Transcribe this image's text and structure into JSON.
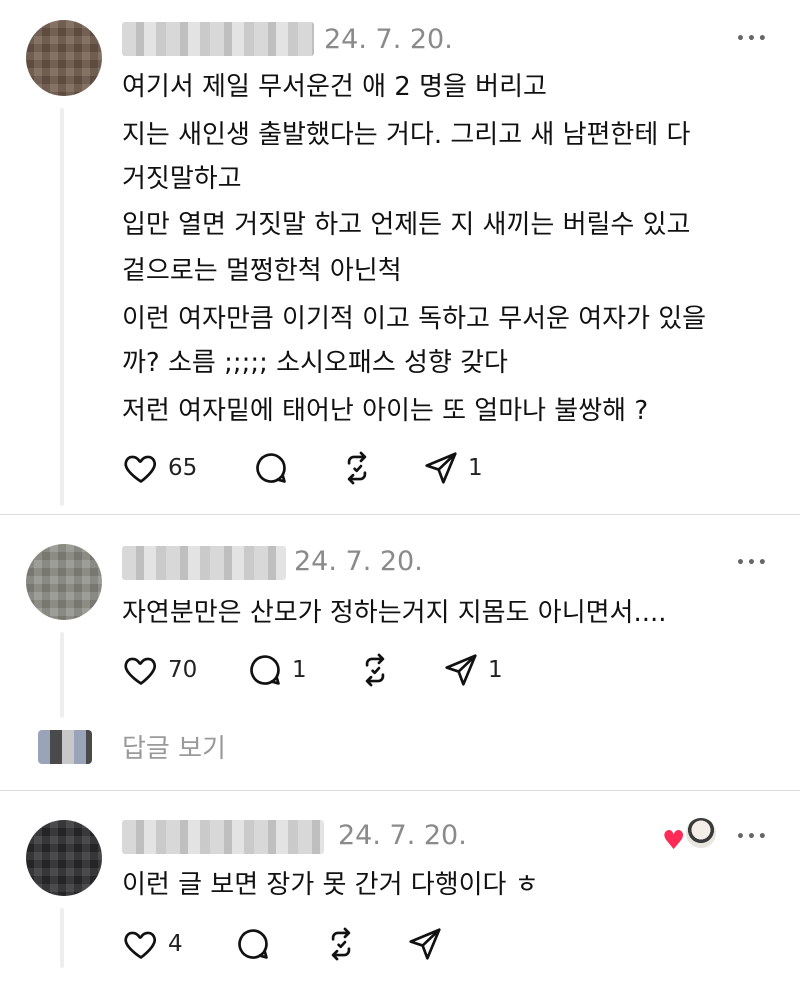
{
  "colors": {
    "liked_heart": "#ff2a55",
    "meta_gray": "#8a8a8a",
    "text": "#111111"
  },
  "comments": [
    {
      "date": "24. 7. 20.",
      "lines": [
        "여기서 제일 무서운건 애 2 명을 버리고",
        "지는 새인생 출발했다는 거다. 그리고 새 남편한테 다",
        "거짓말하고",
        "입만 열면 거짓말 하고 언제든 지 새끼는 버릴수 있고",
        "겉으로는 멀쩡한척 아닌척",
        "이런 여자만큼 이기적 이고 독하고 무서운 여자가 있을",
        "까? 소름 ;;;;; 소시오패스 성향 갖다",
        "저런 여자밑에 태어난 아이는 또 얼마나 불쌍해 ?"
      ],
      "likes": "65",
      "replies": "",
      "reposts": "",
      "shares": "1"
    },
    {
      "date": "24. 7. 20.",
      "lines": [
        "자연분만은 산모가 정하는거지 지몸도 아니면서...."
      ],
      "likes": "70",
      "replies": "1",
      "reposts": "",
      "shares": "1"
    },
    {
      "date": "24. 7. 20.",
      "lines": [
        "이런 글 보면 장가 못 간거 다행이다 ㅎ"
      ],
      "likes": "4",
      "replies": "",
      "reposts": "",
      "shares": ""
    }
  ],
  "view_replies_label": "답글 보기",
  "icons": {
    "more": "more-icon",
    "like": "heart-icon",
    "reply": "comment-icon",
    "repost": "repost-icon",
    "share": "send-icon",
    "liked_by_author": "red-heart-icon"
  },
  "more_glyph": "•••",
  "liked_heart_glyph": "♥"
}
